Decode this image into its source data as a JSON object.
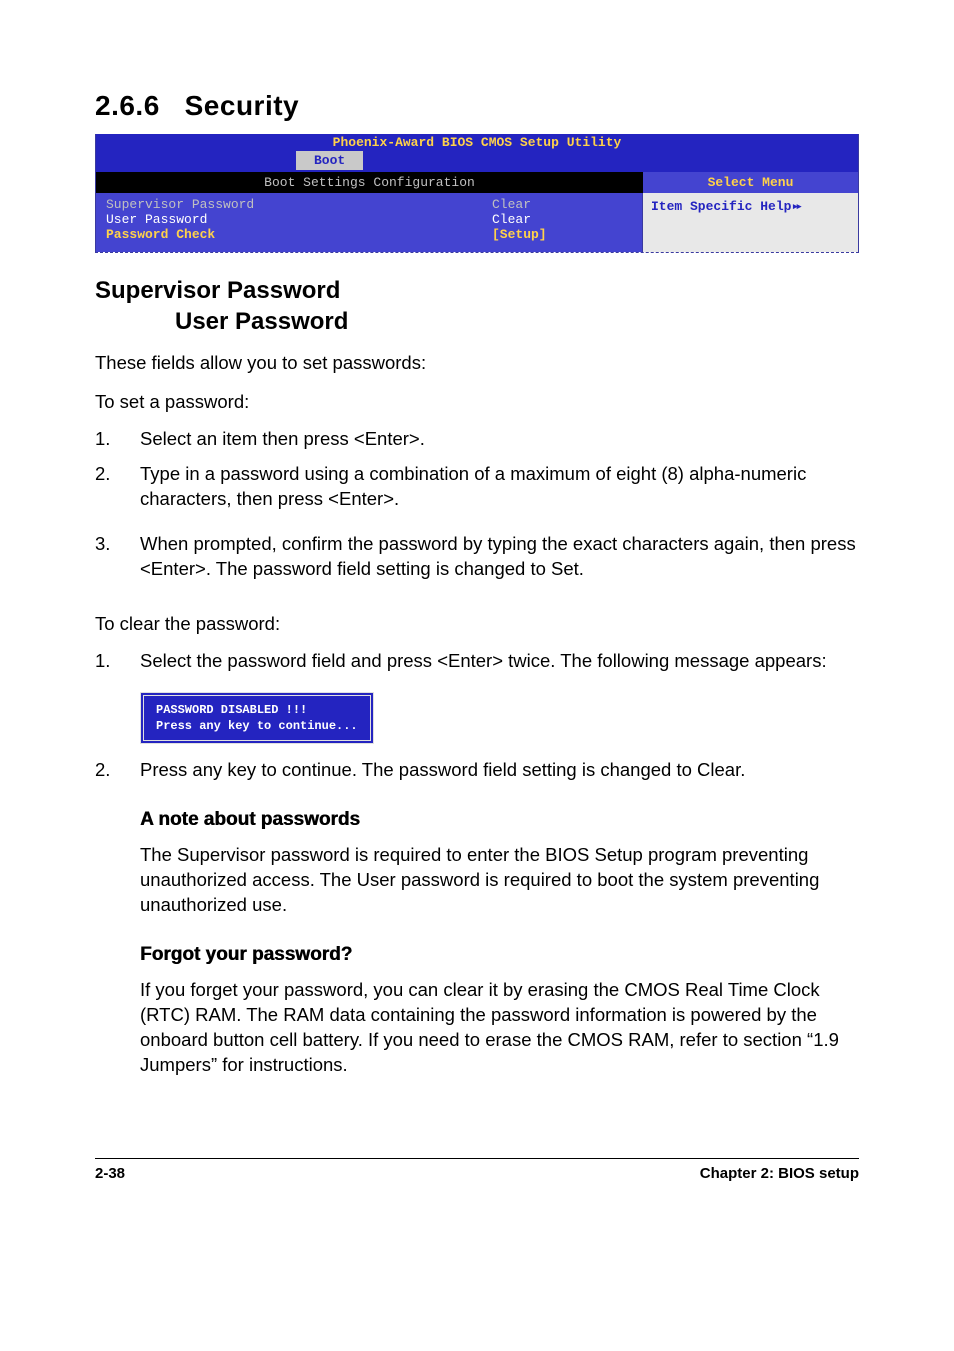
{
  "section": {
    "number": "2.6.6",
    "title": "Security"
  },
  "bios": {
    "utility_title": "Phoenix-Award BIOS CMOS Setup Utility",
    "active_tab": "Boot",
    "left_subtitle": "Boot Settings Configuration",
    "right_subtitle": "Select Menu",
    "rows": [
      {
        "label": "Supervisor Password",
        "value": "Clear",
        "selected": true
      },
      {
        "label": "User Password",
        "value": "Clear",
        "selected": false
      },
      {
        "label": "Password Check",
        "value": "[Setup]",
        "selected": false,
        "highlight": true
      }
    ],
    "help_text": "Item Specific Help"
  },
  "subheading": {
    "line1": "Supervisor Password",
    "line2": "User Password"
  },
  "intro1": "These fields allow you to set passwords:",
  "intro2": "To set a password:",
  "set_steps": [
    "Select an item then press <Enter>.",
    "Type in a password using a combination of a maximum of eight (8) alpha-numeric characters, then press <Enter>.",
    "When prompted, confirm the password by typing the exact characters again, then press <Enter>. The password field setting is changed to Set."
  ],
  "clear_intro": "To clear the password:",
  "clear_steps_1": "Select the password field and press <Enter> twice. The following message appears:",
  "msg_box": "PASSWORD DISABLED !!!\nPress any key to continue...",
  "clear_steps_2": "Press any key to continue. The password field setting is changed to Clear.",
  "note": {
    "title": "A note about passwords",
    "body": "The Supervisor password is required to enter the BIOS Setup program preventing unauthorized access. The User password is required to boot the system preventing unauthorized use."
  },
  "forgot": {
    "title": "Forgot your password?",
    "body": "If you forget your password, you can clear it by erasing the CMOS Real Time Clock (RTC) RAM. The RAM data containing the password information is powered by the onboard button cell battery. If you need to erase the CMOS RAM, refer to section “1.9 Jumpers” for instructions."
  },
  "footer": {
    "page": "2-38",
    "chapter": "Chapter 2: BIOS setup"
  }
}
